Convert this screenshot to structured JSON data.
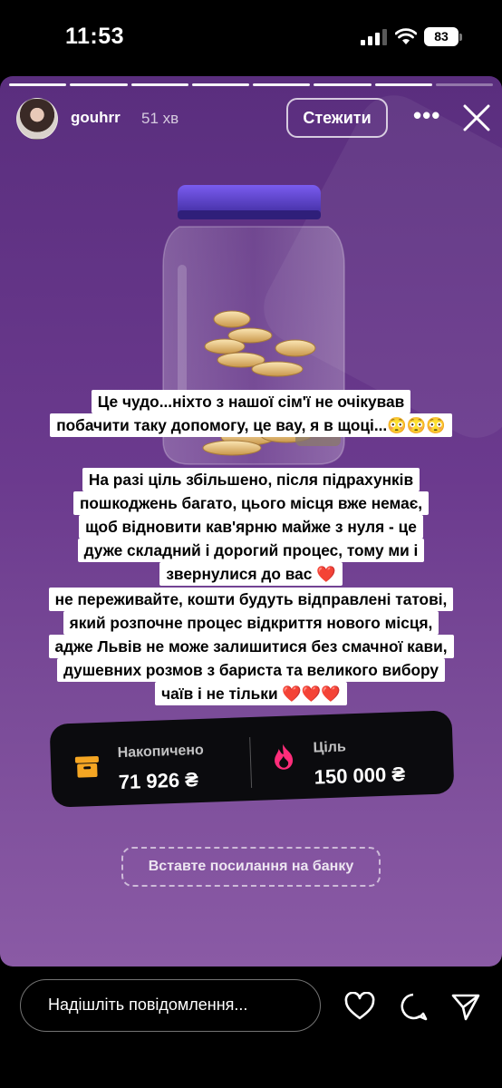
{
  "status_bar": {
    "time": "11:53",
    "battery": "83"
  },
  "story": {
    "progress_segments": 8,
    "active_segment": 7,
    "username": "gouhrr",
    "time_ago": "51 хв",
    "follow_label": "Стежити",
    "more_label": "•••",
    "captions": [
      [
        "Це чудо...ніхто з нашої сім'ї не очікував",
        "побачити таку допомогу, це вау, я в щоці...😳😳😳"
      ],
      [
        "На разі ціль збільшено, після підрахунків",
        "пошкоджень багато, цього місця вже немає,",
        "щоб відновити кав'ярню майже з нуля - це",
        "дуже складний і дорогий процес, тому ми і",
        "звернулися до вас ❤️"
      ],
      [
        "не переживайте, кошти будуть відправлені татові,",
        "який розпочне процес відкриття нового місця,",
        "адже Львів не може залишитися без смачної кави,",
        "душевних розмов з бариста та великого вибору",
        "чаїв і не тільки ❤️❤️❤️"
      ]
    ],
    "fundraiser": {
      "collected_label": "Накопичено",
      "collected_value": "71 926 ₴",
      "goal_label": "Ціль",
      "goal_value": "150 000 ₴",
      "progress_fraction": 0.4795
    },
    "bank_link_label": "Вставте посилання на банку"
  },
  "bottom_bar": {
    "message_placeholder": "Надішліть повідомлення...",
    "icons": [
      "heart-icon",
      "comment-icon",
      "send-icon"
    ]
  },
  "colors": {
    "story_bg": "#6b3a8e",
    "jar_lid": "#5b3fc4",
    "fund_icon_orange": "#f5a623",
    "fund_icon_pink": "#ff2d7a"
  }
}
